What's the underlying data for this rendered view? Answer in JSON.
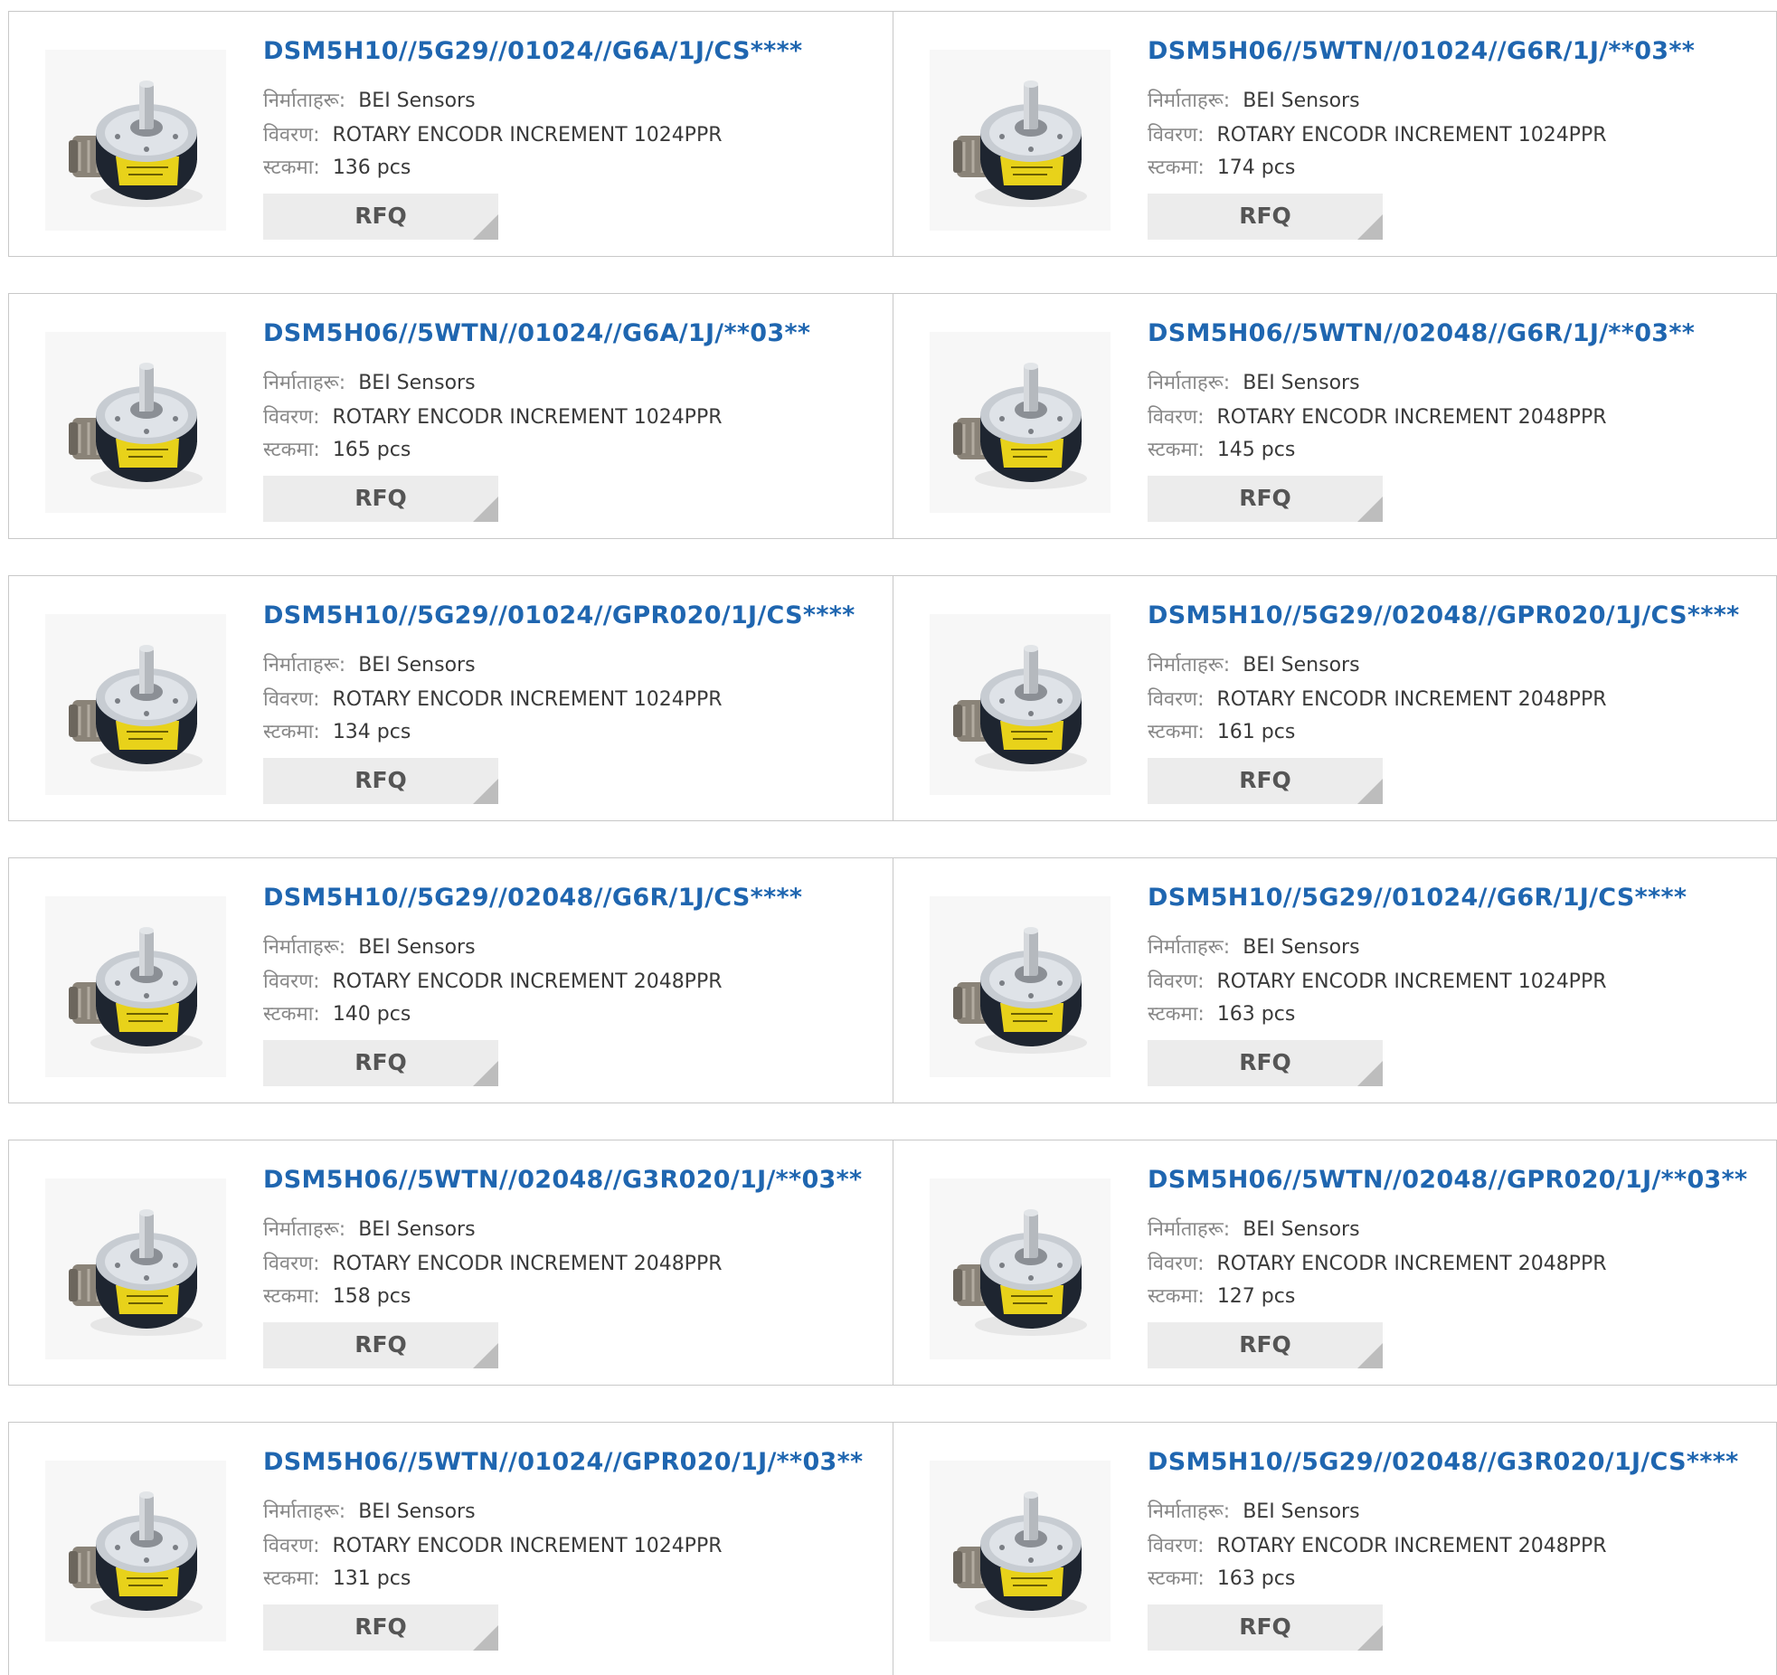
{
  "labels": {
    "manufacturer": "निर्माताहरू:",
    "description": "विवरण:",
    "stock": "स्टकमा:",
    "rfq": "RFQ"
  },
  "colors": {
    "title": "#1f66b0",
    "button_bg": "#ececec",
    "button_corner": "#bdbdbd",
    "border": "#c8c8c8"
  },
  "image_icon": "rotary-encoder-image",
  "products": [
    {
      "title": "DSM5H10//5G29//01024//G6A/1J/CS****",
      "manufacturer": "BEI Sensors",
      "description": "ROTARY ENCODR INCREMENT 1024PPR",
      "stock": "136 pcs"
    },
    {
      "title": "DSM5H06//5WTN//01024//G6R/1J/**03**",
      "manufacturer": "BEI Sensors",
      "description": "ROTARY ENCODR INCREMENT 1024PPR",
      "stock": "174 pcs"
    },
    {
      "title": "DSM5H06//5WTN//01024//G6A/1J/**03**",
      "manufacturer": "BEI Sensors",
      "description": "ROTARY ENCODR INCREMENT 1024PPR",
      "stock": "165 pcs"
    },
    {
      "title": "DSM5H06//5WTN//02048//G6R/1J/**03**",
      "manufacturer": "BEI Sensors",
      "description": "ROTARY ENCODR INCREMENT 2048PPR",
      "stock": "145 pcs"
    },
    {
      "title": "DSM5H10//5G29//01024//GPR020/1J/CS****",
      "manufacturer": "BEI Sensors",
      "description": "ROTARY ENCODR INCREMENT 1024PPR",
      "stock": "134 pcs"
    },
    {
      "title": "DSM5H10//5G29//02048//GPR020/1J/CS****",
      "manufacturer": "BEI Sensors",
      "description": "ROTARY ENCODR INCREMENT 2048PPR",
      "stock": "161 pcs"
    },
    {
      "title": "DSM5H10//5G29//02048//G6R/1J/CS****",
      "manufacturer": "BEI Sensors",
      "description": "ROTARY ENCODR INCREMENT 2048PPR",
      "stock": "140 pcs"
    },
    {
      "title": "DSM5H10//5G29//01024//G6R/1J/CS****",
      "manufacturer": "BEI Sensors",
      "description": "ROTARY ENCODR INCREMENT 1024PPR",
      "stock": "163 pcs"
    },
    {
      "title": "DSM5H06//5WTN//02048//G3R020/1J/**03**",
      "manufacturer": "BEI Sensors",
      "description": "ROTARY ENCODR INCREMENT 2048PPR",
      "stock": "158 pcs"
    },
    {
      "title": "DSM5H06//5WTN//02048//GPR020/1J/**03**",
      "manufacturer": "BEI Sensors",
      "description": "ROTARY ENCODR INCREMENT 2048PPR",
      "stock": "127 pcs"
    },
    {
      "title": "DSM5H06//5WTN//01024//GPR020/1J/**03**",
      "manufacturer": "BEI Sensors",
      "description": "ROTARY ENCODR INCREMENT 1024PPR",
      "stock": "131 pcs"
    },
    {
      "title": "DSM5H10//5G29//02048//G3R020/1J/CS****",
      "manufacturer": "BEI Sensors",
      "description": "ROTARY ENCODR INCREMENT 2048PPR",
      "stock": "163 pcs"
    }
  ]
}
